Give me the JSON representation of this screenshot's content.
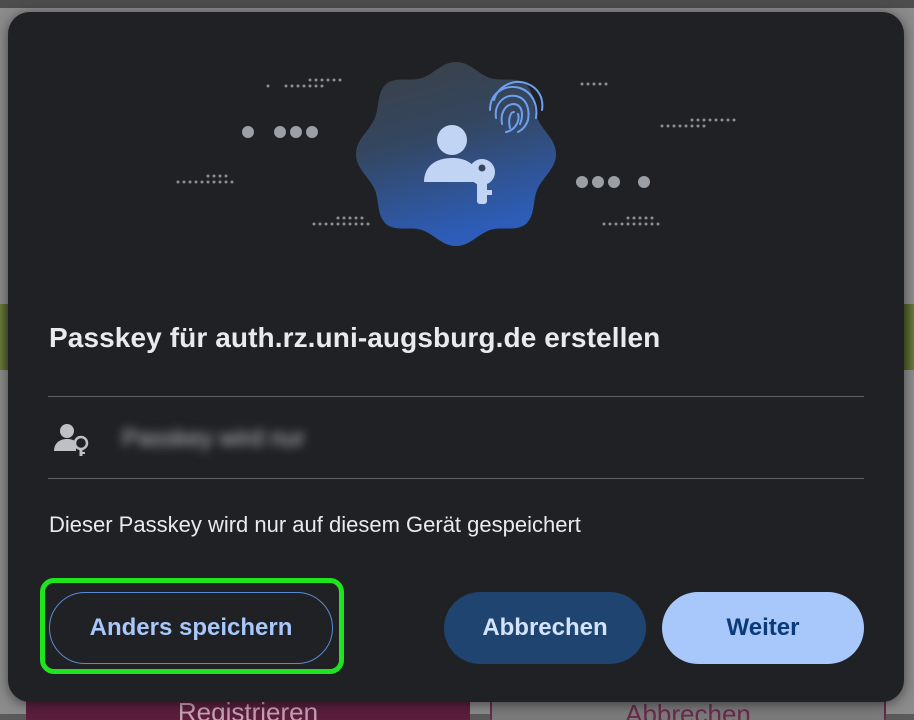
{
  "dialog": {
    "title": "Passkey für auth.rz.uni-augsburg.de erstellen",
    "account_name": "Passkey wird nur",
    "info_text": "Dieser Passkey wird nur auf diesem Gerät gespeichert",
    "buttons": {
      "save_other": "Anders speichern",
      "cancel": "Abbrechen",
      "continue": "Weiter"
    }
  },
  "background_page": {
    "left_button": "Registrieren",
    "right_button": "Abbrechen"
  },
  "icons": {
    "illustration": "passkey-fingerprint-badge-icon",
    "account": "person-key-icon"
  },
  "colors": {
    "dialog_bg": "#202124",
    "accent_primary": "#a8c7fa",
    "accent_tonal": "#1f4470",
    "highlight": "#1fe51f"
  }
}
